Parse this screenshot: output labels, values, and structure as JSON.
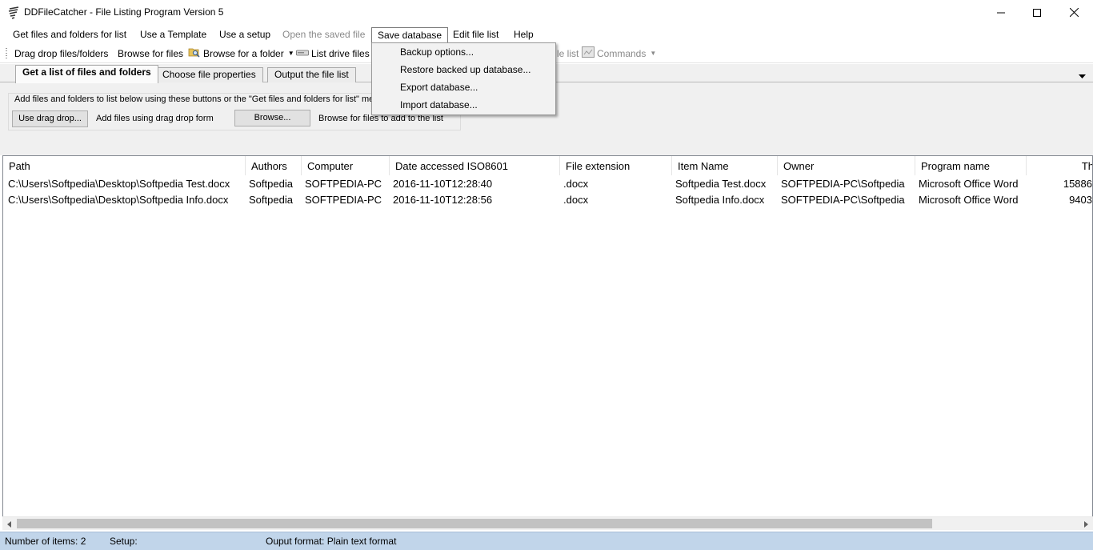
{
  "window": {
    "title": "DDFileCatcher - File Listing Program Version 5",
    "icon": "lines-app-icon"
  },
  "menubar": {
    "items": [
      {
        "label": "Get files and folders for list",
        "enabled": true
      },
      {
        "label": "Use a Template",
        "enabled": true
      },
      {
        "label": "Use a setup",
        "enabled": true
      },
      {
        "label": "Open the saved file",
        "enabled": false
      },
      {
        "label": "Save database",
        "enabled": true,
        "open": true
      },
      {
        "label": "Edit file list",
        "enabled": true
      },
      {
        "label": "Help",
        "enabled": true
      }
    ]
  },
  "save_database_menu": {
    "items": [
      {
        "label": "Backup options..."
      },
      {
        "label": "Restore backed up database..."
      },
      {
        "label": "Export database..."
      },
      {
        "label": "Import database..."
      }
    ]
  },
  "toolbar": {
    "items": [
      {
        "label": "Drag drop files/folders",
        "icon": null
      },
      {
        "label": "Browse for files",
        "icon": null
      },
      {
        "label": "Browse for a folder",
        "icon": "folder-search-icon",
        "has_dropdown": true
      },
      {
        "label": "List drive files",
        "icon": "drive-icon"
      },
      {
        "label": "le list",
        "icon": null,
        "disabled": true
      },
      {
        "label": "Commands",
        "icon": "commands-icon",
        "disabled": true,
        "has_dropdown": true
      }
    ]
  },
  "tabs": [
    {
      "label": "Get a list of files and folders",
      "active": true
    },
    {
      "label": "Choose file properties",
      "active": false
    },
    {
      "label": "Output the file list",
      "active": false
    }
  ],
  "panel": {
    "hint": "Add files and folders to list below using these buttons or the \"Get files and folders for list\" menu",
    "drag_button": "Use drag drop...",
    "drag_label": "Add files using drag drop form",
    "browse_button": "Browse...",
    "browse_label": "Browse for files to add to the list"
  },
  "table": {
    "columns": [
      "Path",
      "Authors",
      "Computer",
      "Date accessed ISO8601",
      "File extension",
      "Item Name",
      "Owner",
      "Program name",
      "Th"
    ],
    "rows": [
      [
        "C:\\Users\\Softpedia\\Desktop\\Softpedia Test.docx",
        "Softpedia",
        "SOFTPEDIA-PC",
        "2016-11-10T12:28:40",
        ".docx",
        "Softpedia Test.docx",
        "SOFTPEDIA-PC\\Softpedia",
        "Microsoft Office Word",
        "15886"
      ],
      [
        "C:\\Users\\Softpedia\\Desktop\\Softpedia Info.docx",
        "Softpedia",
        "SOFTPEDIA-PC",
        "2016-11-10T12:28:56",
        ".docx",
        "Softpedia Info.docx",
        "SOFTPEDIA-PC\\Softpedia",
        "Microsoft Office Word",
        "9403"
      ]
    ]
  },
  "statusbar": {
    "items_count": "Number of items: 2",
    "setup": "Setup:",
    "output_format": "Ouput format: Plain text format"
  },
  "colors": {
    "statusbar": "#c1d5ea",
    "tab_area": "#f0f0f0",
    "menu_bg": "#f2f2f2"
  }
}
